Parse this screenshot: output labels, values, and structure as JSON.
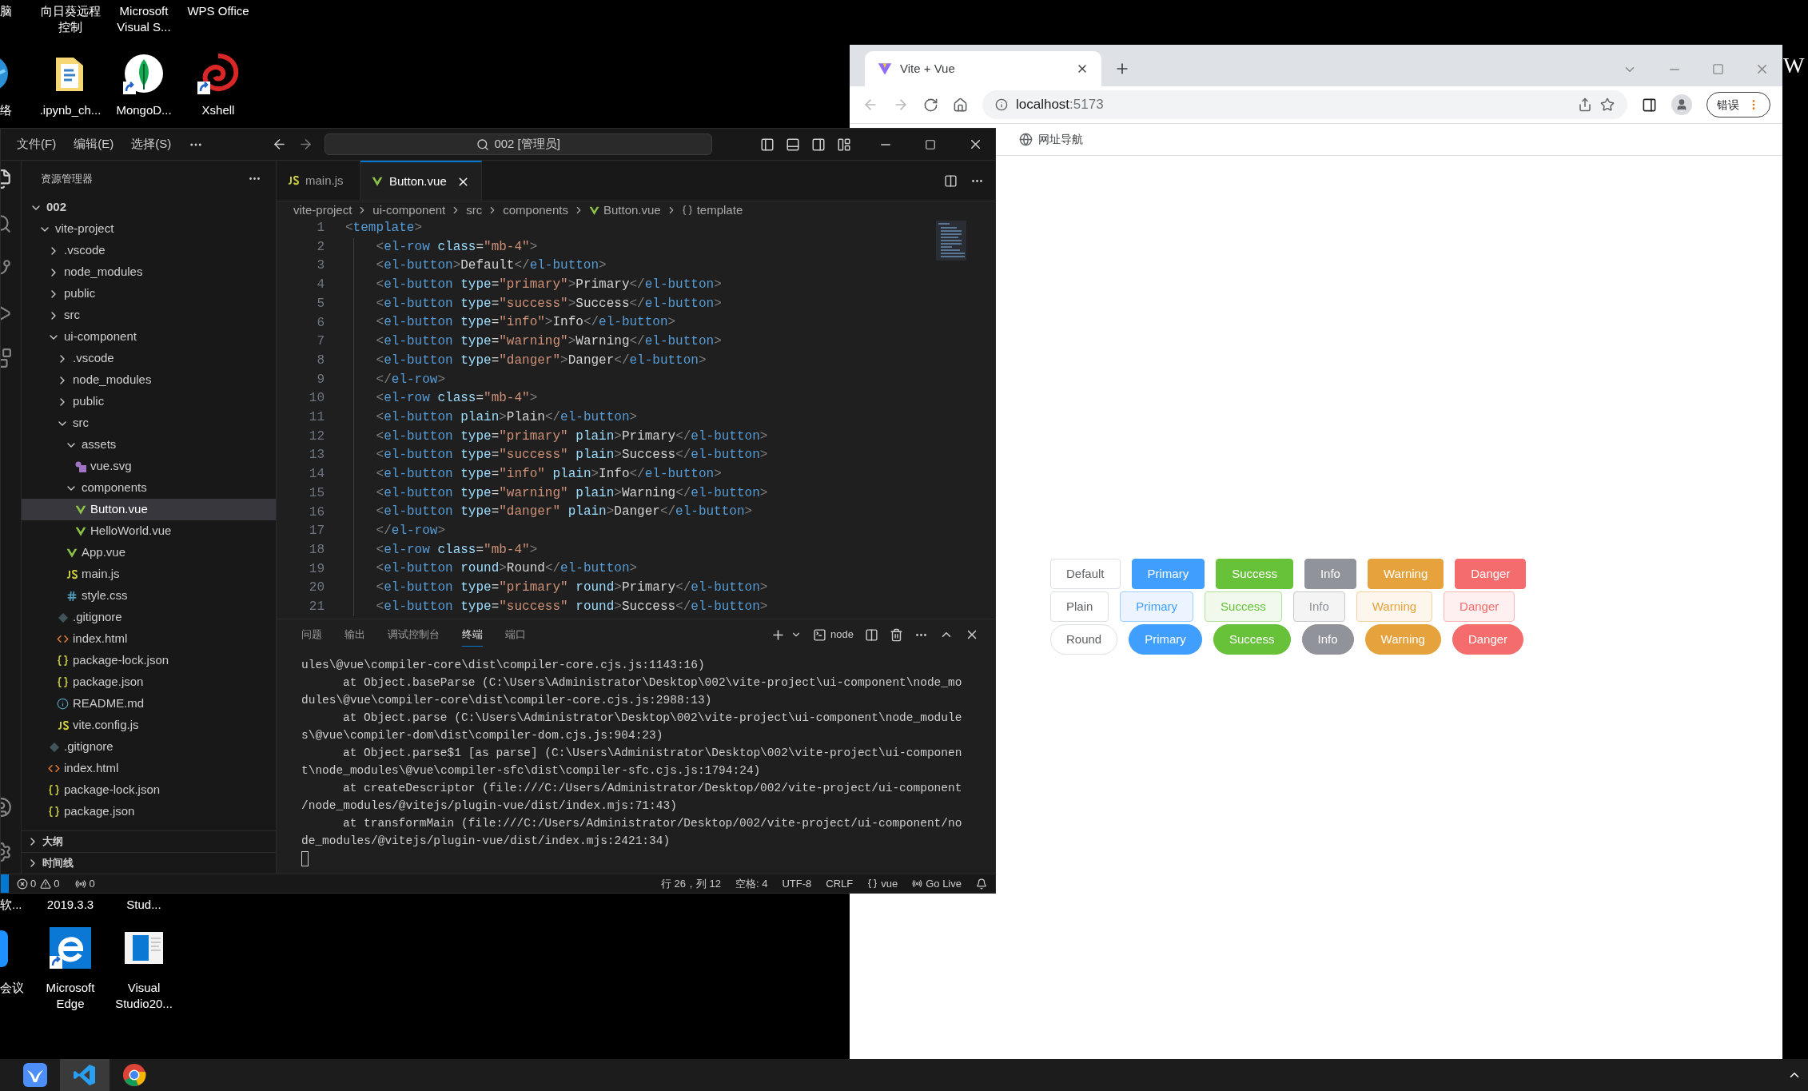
{
  "desktop": {
    "rows": [
      {
        "kind": "labels-top",
        "items": [
          {
            "label": "脑"
          },
          {
            "label": "向日葵远程控制"
          },
          {
            "label": "Microsoft Visual S..."
          },
          {
            "label": "WPS Office"
          }
        ]
      },
      {
        "kind": "icons",
        "items": [
          {
            "label": "络",
            "kind": "globe"
          },
          {
            "label": ".ipynb_ch...",
            "kind": "folder",
            "shortcut": false
          },
          {
            "label": "MongoD...",
            "kind": "leaf",
            "shortcut": true
          },
          {
            "label": "Xshell",
            "kind": "swirl",
            "shortcut": true
          }
        ]
      },
      {
        "kind": "labels-bottom",
        "items": [
          {
            "label": "软..."
          },
          {
            "label": "2019.3.3"
          },
          {
            "label": "Stud..."
          }
        ]
      },
      {
        "kind": "icons-bottom",
        "items": [
          {
            "label": "会议",
            "kind": "app"
          },
          {
            "label": "Microsoft Edge",
            "kind": "edge",
            "shortcut": true
          },
          {
            "label": "Visual Studio20...",
            "kind": "window",
            "shortcut": false
          }
        ]
      }
    ],
    "edge_label": "W"
  },
  "browser": {
    "tab": {
      "title": "Vite + Vue"
    },
    "url_host": "localhost",
    "url_port": ":5173",
    "error_button": "错误",
    "bookmarks": [
      {
        "label": "网址导航"
      }
    ],
    "button_rows": [
      {
        "kind": "solid",
        "buttons": [
          {
            "label": "Default",
            "kind": "default"
          },
          {
            "label": "Primary",
            "kind": "primary"
          },
          {
            "label": "Success",
            "kind": "success"
          },
          {
            "label": "Info",
            "kind": "info"
          },
          {
            "label": "Warning",
            "kind": "warning"
          },
          {
            "label": "Danger",
            "kind": "danger"
          }
        ]
      },
      {
        "kind": "plain",
        "buttons": [
          {
            "label": "Plain",
            "kind": "default"
          },
          {
            "label": "Primary",
            "kind": "primary"
          },
          {
            "label": "Success",
            "kind": "success"
          },
          {
            "label": "Info",
            "kind": "info"
          },
          {
            "label": "Warning",
            "kind": "warning"
          },
          {
            "label": "Danger",
            "kind": "danger"
          }
        ]
      },
      {
        "kind": "round",
        "buttons": [
          {
            "label": "Round",
            "kind": "default"
          },
          {
            "label": "Primary",
            "kind": "primary"
          },
          {
            "label": "Success",
            "kind": "success"
          },
          {
            "label": "Info",
            "kind": "info"
          },
          {
            "label": "Warning",
            "kind": "warning"
          },
          {
            "label": "Danger",
            "kind": "danger"
          }
        ]
      }
    ]
  },
  "vscode": {
    "menu": [
      "文件(F)",
      "编辑(E)",
      "选择(S)"
    ],
    "command_center": "002 [管理员]",
    "explorer": {
      "title": "资源管理器",
      "tree": [
        {
          "label": "002",
          "kind": "root",
          "expanded": true,
          "selected": false,
          "children": [
            {
              "label": "vite-project",
              "kind": "folder",
              "expanded": true,
              "selected": false,
              "children": [
                {
                  "label": ".vscode",
                  "kind": "folder",
                  "expanded": false,
                  "selected": false
                },
                {
                  "label": "node_modules",
                  "kind": "folder",
                  "expanded": false,
                  "selected": false
                },
                {
                  "label": "public",
                  "kind": "folder",
                  "expanded": false,
                  "selected": false
                },
                {
                  "label": "src",
                  "kind": "folder",
                  "expanded": false,
                  "selected": false
                },
                {
                  "label": "ui-component",
                  "kind": "folder",
                  "expanded": true,
                  "selected": false,
                  "children": [
                    {
                      "label": ".vscode",
                      "kind": "folder",
                      "expanded": false,
                      "selected": false
                    },
                    {
                      "label": "node_modules",
                      "kind": "folder",
                      "expanded": false,
                      "selected": false
                    },
                    {
                      "label": "public",
                      "kind": "folder",
                      "expanded": false,
                      "selected": false
                    },
                    {
                      "label": "src",
                      "kind": "folder",
                      "expanded": true,
                      "selected": false,
                      "children": [
                        {
                          "label": "assets",
                          "kind": "folder",
                          "expanded": true,
                          "selected": false,
                          "children": [
                            {
                              "label": "vue.svg",
                              "kind": "svg",
                              "selected": false
                            }
                          ]
                        },
                        {
                          "label": "components",
                          "kind": "folder",
                          "expanded": true,
                          "selected": false,
                          "children": [
                            {
                              "label": "Button.vue",
                              "kind": "vue",
                              "selected": true
                            },
                            {
                              "label": "HelloWorld.vue",
                              "kind": "vue",
                              "selected": false
                            }
                          ]
                        },
                        {
                          "label": "App.vue",
                          "kind": "vue",
                          "selected": false
                        },
                        {
                          "label": "main.js",
                          "kind": "js",
                          "selected": false
                        },
                        {
                          "label": "style.css",
                          "kind": "css",
                          "selected": false
                        }
                      ]
                    },
                    {
                      "label": ".gitignore",
                      "kind": "git",
                      "selected": false
                    },
                    {
                      "label": "index.html",
                      "kind": "html",
                      "selected": false
                    },
                    {
                      "label": "package-lock.json",
                      "kind": "json",
                      "selected": false
                    },
                    {
                      "label": "package.json",
                      "kind": "json",
                      "selected": false
                    },
                    {
                      "label": "README.md",
                      "kind": "info",
                      "selected": false
                    },
                    {
                      "label": "vite.config.js",
                      "kind": "js",
                      "selected": false
                    }
                  ]
                },
                {
                  "label": ".gitignore",
                  "kind": "git",
                  "selected": false
                },
                {
                  "label": "index.html",
                  "kind": "html",
                  "selected": false
                },
                {
                  "label": "package-lock.json",
                  "kind": "json",
                  "selected": false
                },
                {
                  "label": "package.json",
                  "kind": "json",
                  "selected": false
                }
              ]
            }
          ]
        }
      ],
      "sections": [
        {
          "label": "大纲",
          "expanded": false
        },
        {
          "label": "时间线",
          "expanded": false
        }
      ]
    },
    "tabs": [
      {
        "label": "main.js",
        "kind": "js",
        "selected": false
      },
      {
        "label": "Button.vue",
        "kind": "vue",
        "selected": true
      }
    ],
    "breadcrumb": [
      {
        "label": "vite-project",
        "kind": "text"
      },
      {
        "label": "ui-component",
        "kind": "text"
      },
      {
        "label": "src",
        "kind": "text"
      },
      {
        "label": "components",
        "kind": "text"
      },
      {
        "label": "Button.vue",
        "kind": "vue"
      },
      {
        "label": "template",
        "kind": "braces"
      }
    ],
    "code": [
      {
        "number": "1",
        "indented": false,
        "text": "<template>"
      },
      {
        "number": "2",
        "indented": true,
        "text": "<el-row class=\"mb-4\">"
      },
      {
        "number": "3",
        "indented": true,
        "text": "<el-button>Default</el-button>"
      },
      {
        "number": "4",
        "indented": true,
        "text": "<el-button type=\"primary\">Primary</el-button>"
      },
      {
        "number": "5",
        "indented": true,
        "text": "<el-button type=\"success\">Success</el-button>"
      },
      {
        "number": "6",
        "indented": true,
        "text": "<el-button type=\"info\">Info</el-button>"
      },
      {
        "number": "7",
        "indented": true,
        "text": "<el-button type=\"warning\">Warning</el-button>"
      },
      {
        "number": "8",
        "indented": true,
        "text": "<el-button type=\"danger\">Danger</el-button>"
      },
      {
        "number": "9",
        "indented": true,
        "text": "</el-row>"
      },
      {
        "number": "10",
        "indented": true,
        "text": "<el-row class=\"mb-4\">"
      },
      {
        "number": "11",
        "indented": true,
        "text": "<el-button plain>Plain</el-button>"
      },
      {
        "number": "12",
        "indented": true,
        "text": "<el-button type=\"primary\" plain>Primary</el-button>"
      },
      {
        "number": "13",
        "indented": true,
        "text": "<el-button type=\"success\" plain>Success</el-button>"
      },
      {
        "number": "14",
        "indented": true,
        "text": "<el-button type=\"info\" plain>Info</el-button>"
      },
      {
        "number": "15",
        "indented": true,
        "text": "<el-button type=\"warning\" plain>Warning</el-button>"
      },
      {
        "number": "16",
        "indented": true,
        "text": "<el-button type=\"danger\" plain>Danger</el-button>"
      },
      {
        "number": "17",
        "indented": true,
        "text": "</el-row>"
      },
      {
        "number": "18",
        "indented": true,
        "text": "<el-row class=\"mb-4\">"
      },
      {
        "number": "19",
        "indented": true,
        "text": "<el-button round>Round</el-button>"
      },
      {
        "number": "20",
        "indented": true,
        "text": "<el-button type=\"primary\" round>Primary</el-button>"
      },
      {
        "number": "21",
        "indented": true,
        "text": "<el-button type=\"success\" round>Success</el-button>"
      }
    ],
    "panel": {
      "tabs": [
        {
          "label": "问题",
          "selected": false
        },
        {
          "label": "输出",
          "selected": false
        },
        {
          "label": "调试控制台",
          "selected": false
        },
        {
          "label": "终端",
          "selected": true
        },
        {
          "label": "端口",
          "selected": false
        }
      ],
      "terminal_name": "node",
      "lines": [
        {
          "text": "ules\\@vue\\compiler-core\\dist\\compiler-core.cjs.js:1143:16)",
          "indented": false
        },
        {
          "text": "at Object.baseParse (C:\\Users\\Administrator\\Desktop\\002\\vite-project\\ui-component\\node_mo",
          "indented": true
        },
        {
          "text": "dules\\@vue\\compiler-core\\dist\\compiler-core.cjs.js:2988:13)",
          "indented": false
        },
        {
          "text": "at Object.parse (C:\\Users\\Administrator\\Desktop\\002\\vite-project\\ui-component\\node_module",
          "indented": true
        },
        {
          "text": "s\\@vue\\compiler-dom\\dist\\compiler-dom.cjs.js:904:23)",
          "indented": false
        },
        {
          "text": "at Object.parse$1 [as parse] (C:\\Users\\Administrator\\Desktop\\002\\vite-project\\ui-componen",
          "indented": true
        },
        {
          "text": "t\\node_modules\\@vue\\compiler-sfc\\dist\\compiler-sfc.cjs.js:1794:24)",
          "indented": false
        },
        {
          "text": "at createDescriptor (file:///C:/Users/Administrator/Desktop/002/vite-project/ui-component",
          "indented": true
        },
        {
          "text": "/node_modules/@vitejs/plugin-vue/dist/index.mjs:71:43)",
          "indented": false
        },
        {
          "text": "at transformMain (file:///C:/Users/Administrator/Desktop/002/vite-project/ui-component/no",
          "indented": true
        },
        {
          "text": "de_modules/@vitejs/plugin-vue/dist/index.mjs:2421:34)",
          "indented": false
        }
      ]
    },
    "status_bar": {
      "errors": "0",
      "warnings": "0",
      "ports": "0",
      "items": [
        {
          "label": "行 26，列 12",
          "kind": "text"
        },
        {
          "label": "空格: 4",
          "kind": "text"
        },
        {
          "label": "UTF-8",
          "kind": "text"
        },
        {
          "label": "CRLF",
          "kind": "text"
        },
        {
          "label": "vue",
          "kind": "braces"
        },
        {
          "label": "Go Live",
          "kind": "radio"
        }
      ]
    }
  },
  "taskbar": {
    "apps": [
      {
        "kind": "bird",
        "selected": false
      },
      {
        "kind": "ribbon",
        "selected": true
      },
      {
        "kind": "wheel",
        "selected": false
      }
    ]
  }
}
